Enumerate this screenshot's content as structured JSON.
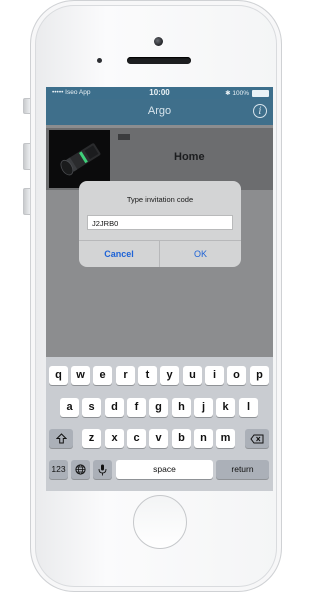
{
  "status_bar": {
    "carrier": "••••• Iseo App",
    "time": "10:00",
    "battery": "✱ 100%"
  },
  "nav": {
    "title": "Argo",
    "info_icon": "info-icon"
  },
  "lock": {
    "name": "Home"
  },
  "dialog": {
    "title": "Type invitation code",
    "input_value": "J2JRB0",
    "cancel_label": "Cancel",
    "ok_label": "OK"
  },
  "keyboard": {
    "row1": [
      "q",
      "w",
      "e",
      "r",
      "t",
      "y",
      "u",
      "i",
      "o",
      "p"
    ],
    "row2": [
      "a",
      "s",
      "d",
      "f",
      "g",
      "h",
      "j",
      "k",
      "l"
    ],
    "row3": [
      "z",
      "x",
      "c",
      "v",
      "b",
      "n",
      "m"
    ],
    "shift_icon": "shift-icon",
    "delete_icon": "delete-icon",
    "numbers_label": "123",
    "globe_icon": "globe-icon",
    "mic_icon": "microphone-icon",
    "space_label": "space",
    "return_label": "return"
  },
  "colors": {
    "nav_bar": "#3f6f8b",
    "dialog_button": "#1e63d6",
    "keyboard_bg": "#c9ccd1"
  }
}
